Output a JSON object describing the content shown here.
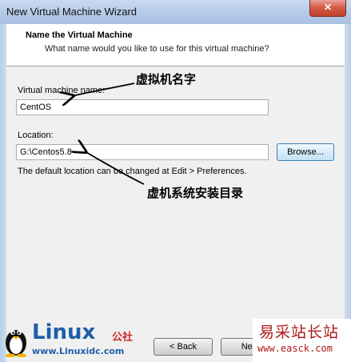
{
  "window": {
    "title": "New Virtual Machine Wizard",
    "close_glyph": "✕"
  },
  "header": {
    "title": "Name the Virtual Machine",
    "subtitle": "What name would you like to use for this virtual machine?"
  },
  "form": {
    "vm_name_label": "Virtual machine name:",
    "vm_name_value": "CentOS",
    "location_label": "Location:",
    "location_value": "G:\\Centos5.8",
    "browse_label": "Browse...",
    "hint": "The default location can be changed at Edit > Preferences."
  },
  "annotations": {
    "name_note": "虚拟机名字",
    "location_note": "虚机系统安装目录"
  },
  "footer": {
    "back_label": "< Back",
    "next_label": "Next"
  },
  "watermarks": {
    "linux_word": "Linux",
    "linux_cn": "公社",
    "linux_url": "www.Linuxidc.com",
    "easck_title": "易采站长站",
    "easck_url": "www.easck.com"
  }
}
